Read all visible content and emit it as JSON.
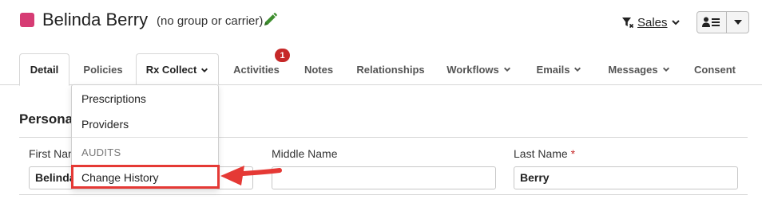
{
  "header": {
    "client_name": "Belinda Berry",
    "group_note": "(no group or carrier)",
    "sales_label": "Sales",
    "color_square": "#d63c74"
  },
  "tabs": [
    {
      "label": "Detail"
    },
    {
      "label": "Policies"
    },
    {
      "label": "Rx Collect"
    },
    {
      "label": "Activities",
      "badge": "1"
    },
    {
      "label": "Notes"
    },
    {
      "label": "Relationships"
    },
    {
      "label": "Workflows"
    },
    {
      "label": "Emails"
    },
    {
      "label": "Messages"
    },
    {
      "label": "Consent"
    }
  ],
  "dropdown": {
    "items": [
      "Prescriptions",
      "Providers"
    ],
    "section_header": "AUDITS",
    "audit_items": [
      "Change History"
    ]
  },
  "section": {
    "title": "Persona",
    "fields": [
      {
        "label": "First Nam",
        "value": "Belinda"
      },
      {
        "label": "Middle Name",
        "value": ""
      },
      {
        "label": "Last Name",
        "required_mark": "*",
        "value": "Berry"
      }
    ]
  },
  "colors": {
    "accent_red": "#e53935",
    "badge_red": "#c62828",
    "pencil_green": "#3e8e2f"
  }
}
